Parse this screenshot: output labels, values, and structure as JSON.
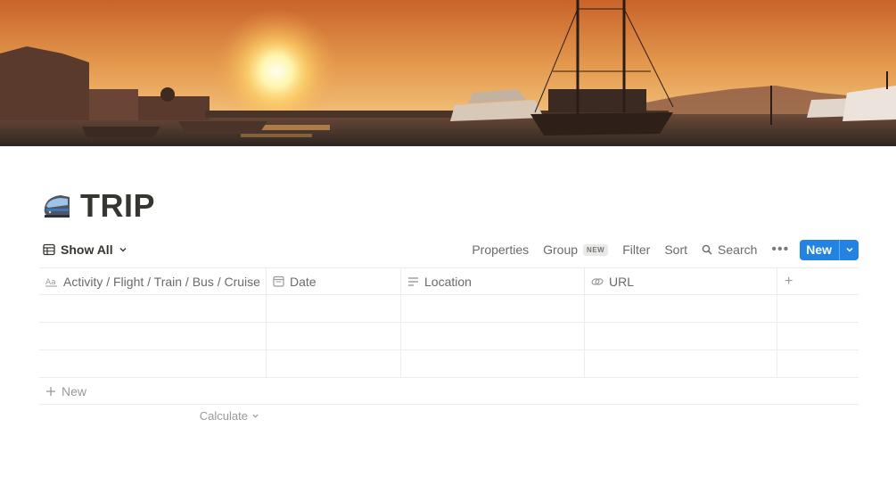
{
  "page": {
    "title": "TRIP",
    "icon": "train-icon"
  },
  "cover": {
    "description_icon": "harbor-sunset-cover"
  },
  "toolbar": {
    "view_label": "Show All",
    "properties_label": "Properties",
    "group_label": "Group",
    "group_badge": "NEW",
    "filter_label": "Filter",
    "sort_label": "Sort",
    "search_label": "Search",
    "more_label": "•••",
    "new_label": "New"
  },
  "table": {
    "columns": [
      {
        "label": "Activity / Flight / Train / Bus / Cruise",
        "icon": "text-property-icon"
      },
      {
        "label": "Date",
        "icon": "calendar-icon"
      },
      {
        "label": "Location",
        "icon": "text-lines-icon"
      },
      {
        "label": "URL",
        "icon": "link-icon"
      }
    ],
    "add_column_label": "+",
    "rows": [
      [
        "",
        "",
        "",
        ""
      ],
      [
        "",
        "",
        "",
        ""
      ],
      [
        "",
        "",
        "",
        ""
      ]
    ],
    "new_row_label": "New",
    "calculate_label": "Calculate"
  },
  "colors": {
    "accent": "#2383e2",
    "text": "#37352f",
    "muted": "#787774",
    "border": "#ededec"
  }
}
